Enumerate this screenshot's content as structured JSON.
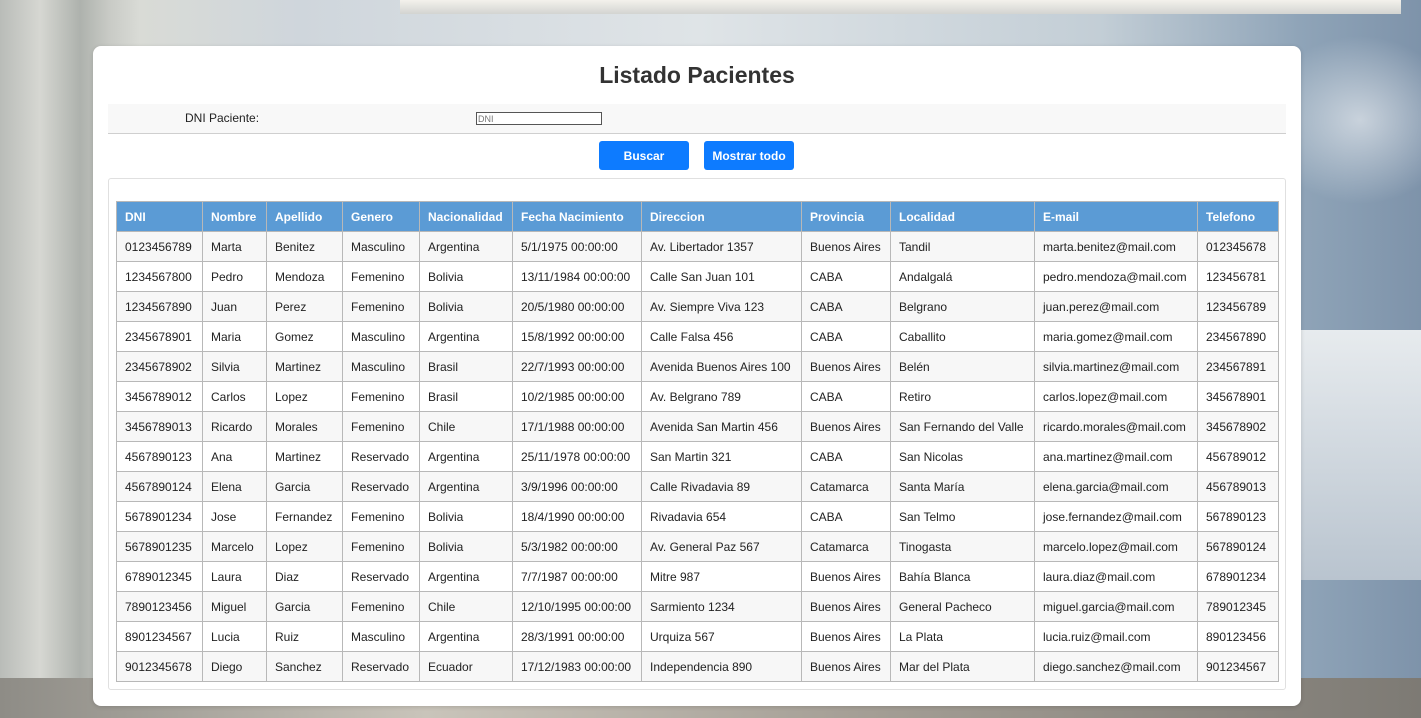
{
  "page": {
    "title": "Listado Pacientes"
  },
  "search": {
    "label": "DNI Paciente:",
    "placeholder": "DNI",
    "value": ""
  },
  "buttons": {
    "search_label": "Buscar",
    "show_all_label": "Mostrar todo"
  },
  "colors": {
    "header_bg": "#5b9bd5",
    "button_bg": "#0d7bff"
  },
  "table": {
    "columns": [
      "DNI",
      "Nombre",
      "Apellido",
      "Genero",
      "Nacionalidad",
      "Fecha Nacimiento",
      "Direccion",
      "Provincia",
      "Localidad",
      "E-mail",
      "Telefono"
    ],
    "rows": [
      [
        "0123456789",
        "Marta",
        "Benitez",
        "Masculino",
        "Argentina",
        "5/1/1975 00:00:00",
        "Av. Libertador 1357",
        "Buenos Aires",
        "Tandil",
        "marta.benitez@mail.com",
        "012345678"
      ],
      [
        "1234567800",
        "Pedro",
        "Mendoza",
        "Femenino",
        "Bolivia",
        "13/11/1984 00:00:00",
        "Calle San Juan 101",
        "CABA",
        "Andalgalá",
        "pedro.mendoza@mail.com",
        "123456781"
      ],
      [
        "1234567890",
        "Juan",
        "Perez",
        "Femenino",
        "Bolivia",
        "20/5/1980 00:00:00",
        "Av. Siempre Viva 123",
        "CABA",
        "Belgrano",
        "juan.perez@mail.com",
        "123456789"
      ],
      [
        "2345678901",
        "Maria",
        "Gomez",
        "Masculino",
        "Argentina",
        "15/8/1992 00:00:00",
        "Calle Falsa 456",
        "CABA",
        "Caballito",
        "maria.gomez@mail.com",
        "234567890"
      ],
      [
        "2345678902",
        "Silvia",
        "Martinez",
        "Masculino",
        "Brasil",
        "22/7/1993 00:00:00",
        "Avenida Buenos Aires 100",
        "Buenos Aires",
        "Belén",
        "silvia.martinez@mail.com",
        "234567891"
      ],
      [
        "3456789012",
        "Carlos",
        "Lopez",
        "Femenino",
        "Brasil",
        "10/2/1985 00:00:00",
        "Av. Belgrano 789",
        "CABA",
        "Retiro",
        "carlos.lopez@mail.com",
        "345678901"
      ],
      [
        "3456789013",
        "Ricardo",
        "Morales",
        "Femenino",
        "Chile",
        "17/1/1988 00:00:00",
        "Avenida San Martin 456",
        "Buenos Aires",
        "San Fernando del Valle",
        "ricardo.morales@mail.com",
        "345678902"
      ],
      [
        "4567890123",
        "Ana",
        "Martinez",
        "Reservado",
        "Argentina",
        "25/11/1978 00:00:00",
        "San Martin 321",
        "CABA",
        "San Nicolas",
        "ana.martinez@mail.com",
        "456789012"
      ],
      [
        "4567890124",
        "Elena",
        "Garcia",
        "Reservado",
        "Argentina",
        "3/9/1996 00:00:00",
        "Calle Rivadavia 89",
        "Catamarca",
        "Santa María",
        "elena.garcia@mail.com",
        "456789013"
      ],
      [
        "5678901234",
        "Jose",
        "Fernandez",
        "Femenino",
        "Bolivia",
        "18/4/1990 00:00:00",
        "Rivadavia 654",
        "CABA",
        "San Telmo",
        "jose.fernandez@mail.com",
        "567890123"
      ],
      [
        "5678901235",
        "Marcelo",
        "Lopez",
        "Femenino",
        "Bolivia",
        "5/3/1982 00:00:00",
        "Av. General Paz 567",
        "Catamarca",
        "Tinogasta",
        "marcelo.lopez@mail.com",
        "567890124"
      ],
      [
        "6789012345",
        "Laura",
        "Diaz",
        "Reservado",
        "Argentina",
        "7/7/1987 00:00:00",
        "Mitre 987",
        "Buenos Aires",
        "Bahía Blanca",
        "laura.diaz@mail.com",
        "678901234"
      ],
      [
        "7890123456",
        "Miguel",
        "Garcia",
        "Femenino",
        "Chile",
        "12/10/1995 00:00:00",
        "Sarmiento 1234",
        "Buenos Aires",
        "General Pacheco",
        "miguel.garcia@mail.com",
        "789012345"
      ],
      [
        "8901234567",
        "Lucia",
        "Ruiz",
        "Masculino",
        "Argentina",
        "28/3/1991 00:00:00",
        "Urquiza 567",
        "Buenos Aires",
        "La Plata",
        "lucia.ruiz@mail.com",
        "890123456"
      ],
      [
        "9012345678",
        "Diego",
        "Sanchez",
        "Reservado",
        "Ecuador",
        "17/12/1983 00:00:00",
        "Independencia 890",
        "Buenos Aires",
        "Mar del Plata",
        "diego.sanchez@mail.com",
        "901234567"
      ]
    ]
  }
}
